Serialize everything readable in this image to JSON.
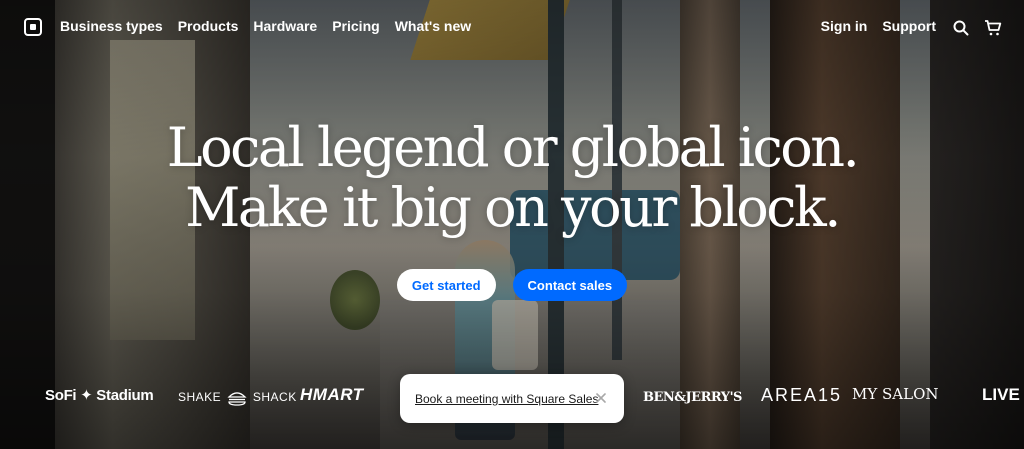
{
  "nav": {
    "left_links": [
      {
        "label": "Business types",
        "name": "nav-business-types"
      },
      {
        "label": "Products",
        "name": "nav-products"
      },
      {
        "label": "Hardware",
        "name": "nav-hardware"
      },
      {
        "label": "Pricing",
        "name": "nav-pricing"
      },
      {
        "label": "What's new",
        "name": "nav-whats-new"
      }
    ],
    "right_links": [
      {
        "label": "Sign in",
        "name": "nav-sign-in"
      },
      {
        "label": "Support",
        "name": "nav-support"
      }
    ],
    "icons": [
      "search-icon",
      "cart-icon"
    ],
    "logo_icon": "square-logo-icon"
  },
  "hero": {
    "headline_line1": "Local legend or global icon.",
    "headline_line2": "Make it big on your block.",
    "cta_primary": "Get started",
    "cta_secondary": "Contact sales"
  },
  "brands": {
    "sofi": "SoFi ✦ Stadium",
    "shake_left": "SHAKE",
    "shake_right": "SHACK",
    "hmart": "HMART",
    "benjerry": "BEN&JERRY'S",
    "area15": "AREA15",
    "mysalon": "MY SALON",
    "livebyt": "LIVE BY T"
  },
  "popup": {
    "link_label": "Book a meeting with Square Sales",
    "close_icon": "close-icon"
  },
  "colors": {
    "brand_blue": "#006aff",
    "nav_text": "#ffffff",
    "popup_bg": "#ffffff"
  }
}
